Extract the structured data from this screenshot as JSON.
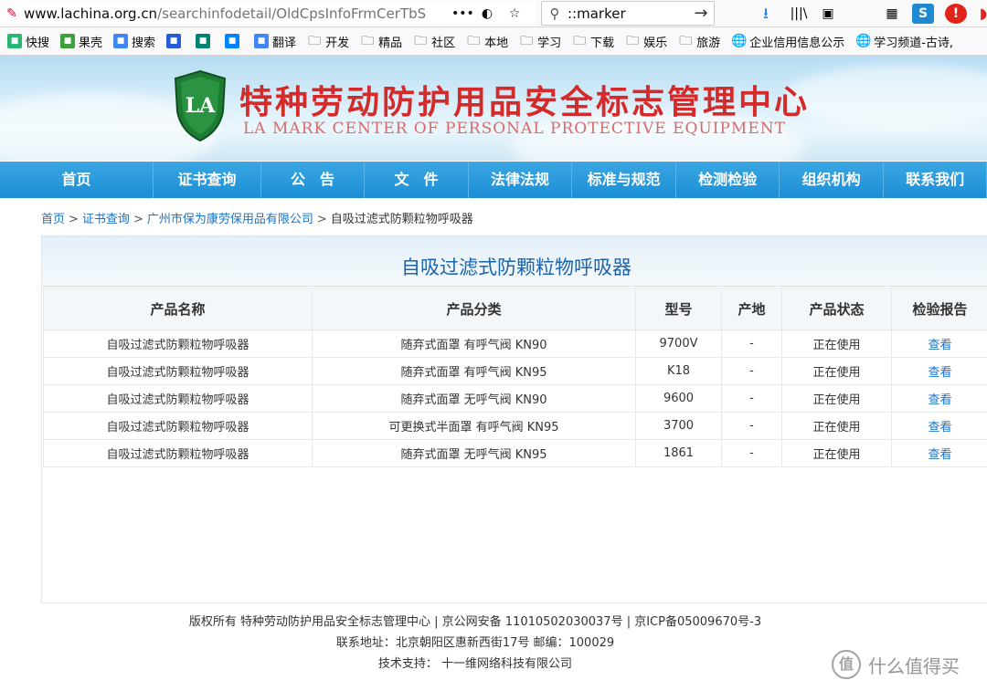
{
  "browser": {
    "url_domain": "www.lachina.org.cn",
    "url_path": "/searchinfodetail/OldCpsInfoFrmCerTbS",
    "search_query": "::marker"
  },
  "bookmarks": [
    {
      "label": "快搜",
      "icon": "kuaisou-icon",
      "color": "#2bb673"
    },
    {
      "label": "果壳",
      "icon": "guoke-icon",
      "color": "#3f9f3c"
    },
    {
      "label": "搜索",
      "icon": "google-icon",
      "color": "#4285f4"
    },
    {
      "label": "",
      "icon": "baidu-icon",
      "color": "#2a5bd7"
    },
    {
      "label": "",
      "icon": "bing-icon",
      "color": "#008373"
    },
    {
      "label": "",
      "icon": "zhihu-icon",
      "color": "#0084ff"
    },
    {
      "label": "翻译",
      "icon": "translate-icon",
      "color": "#4285f4"
    },
    {
      "label": "开发",
      "icon": "folder-icon",
      "color": ""
    },
    {
      "label": "精品",
      "icon": "folder-icon",
      "color": ""
    },
    {
      "label": "社区",
      "icon": "folder-icon",
      "color": ""
    },
    {
      "label": "本地",
      "icon": "folder-icon",
      "color": ""
    },
    {
      "label": "学习",
      "icon": "folder-icon",
      "color": ""
    },
    {
      "label": "下载",
      "icon": "folder-icon",
      "color": ""
    },
    {
      "label": "娱乐",
      "icon": "folder-icon",
      "color": ""
    },
    {
      "label": "旅游",
      "icon": "folder-icon",
      "color": ""
    },
    {
      "label": "企业信用信息公示",
      "icon": "globe-icon",
      "color": ""
    },
    {
      "label": "学习频道-古诗,",
      "icon": "globe-icon",
      "color": ""
    }
  ],
  "site": {
    "logo_text": "LA",
    "title": "特种劳动防护用品安全标志管理中心",
    "subtitle": "LA MARK CENTER OF PERSONAL PROTECTIVE EQUIPMENT"
  },
  "nav": [
    "首页",
    "证书查询",
    "公　告",
    "文　件",
    "法律法规",
    "标准与规范",
    "检测检验",
    "组织机构",
    "联系我们"
  ],
  "breadcrumb": [
    "首页",
    "证书查询",
    "广州市保为康劳保用品有限公司",
    "自吸过滤式防颗粒物呼吸器"
  ],
  "panel_title": "自吸过滤式防颗粒物呼吸器",
  "table": {
    "headers": [
      "产品名称",
      "产品分类",
      "型号",
      "产地",
      "产品状态",
      "检验报告"
    ],
    "rows": [
      [
        "自吸过滤式防颗粒物呼吸器",
        "随弃式面罩 有呼气阀 KN90",
        "9700V",
        "-",
        "正在使用",
        "查看"
      ],
      [
        "自吸过滤式防颗粒物呼吸器",
        "随弃式面罩 有呼气阀 KN95",
        "K18",
        "-",
        "正在使用",
        "查看"
      ],
      [
        "自吸过滤式防颗粒物呼吸器",
        "随弃式面罩 无呼气阀 KN90",
        "9600",
        "-",
        "正在使用",
        "查看"
      ],
      [
        "自吸过滤式防颗粒物呼吸器",
        "可更换式半面罩 有呼气阀 KN95",
        "3700",
        "-",
        "正在使用",
        "查看"
      ],
      [
        "自吸过滤式防颗粒物呼吸器",
        "随弃式面罩 无呼气阀 KN95",
        "1861",
        "-",
        "正在使用",
        "查看"
      ]
    ]
  },
  "footer": {
    "line1": "版权所有 特种劳动防护用品安全标志管理中心 | 京公网安备 11010502030037号 | 京ICP备05009670号-3",
    "line2": "联系地址：北京朝阳区惠新西街17号 邮编：100029",
    "line3": "技术支持： 十一维网络科技有限公司"
  },
  "watermark": "什么值得买",
  "colors": {
    "nav_bg": "#1d8fd6",
    "title_red": "#d52a2a",
    "link_blue": "#1a73c8",
    "panel_title": "#1a63ad"
  }
}
